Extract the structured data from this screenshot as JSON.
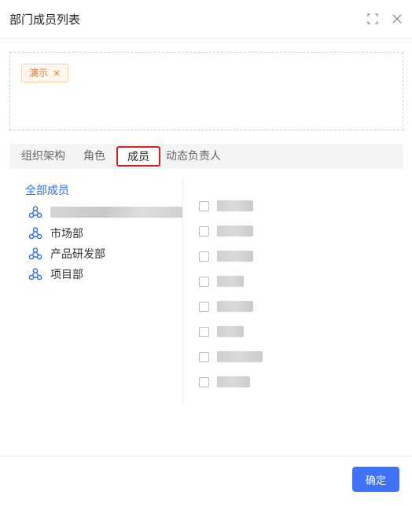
{
  "dialog": {
    "title": "部门成员列表",
    "icons": {
      "maximize": "maximize-icon",
      "close": "close-icon"
    }
  },
  "selected": {
    "tags": [
      {
        "label": "演示",
        "remove": "×"
      }
    ]
  },
  "tabs": {
    "items": [
      {
        "label": "组织架构"
      },
      {
        "label": "角色"
      },
      {
        "label": "成员",
        "active": true
      },
      {
        "label": "动态负责人"
      }
    ]
  },
  "departments": {
    "all_label": "全部成员",
    "items": [
      {
        "label": "",
        "blurred": true
      },
      {
        "label": "市场部"
      },
      {
        "label": "产品研发部"
      },
      {
        "label": "项目部"
      }
    ],
    "icon": "organization-icon"
  },
  "members": {
    "count": 8,
    "names_blurred": true
  },
  "footer": {
    "confirm_label": "确定"
  },
  "colors": {
    "accent": "#3f72f6",
    "link": "#2f6fe4",
    "tag_text": "#ea7a1f",
    "tag_bg": "#fff7ee",
    "highlight_border": "#e02020"
  }
}
